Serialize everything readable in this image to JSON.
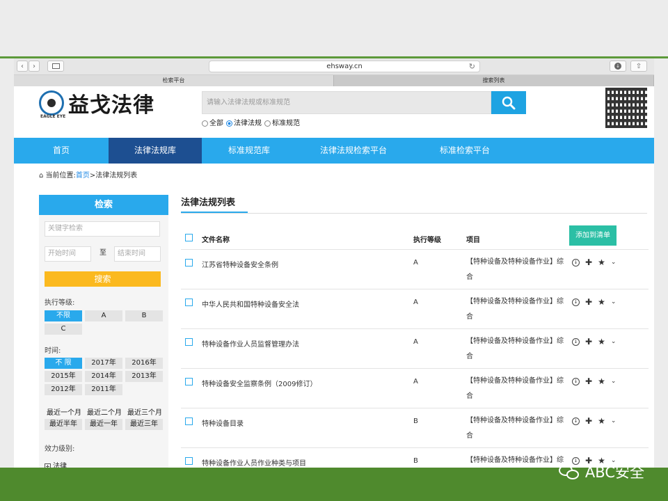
{
  "browser": {
    "url": "ehsway.cn",
    "tabs": [
      "检索平台",
      "搜索列表"
    ]
  },
  "header": {
    "logo_text": "益戈法律",
    "logo_sub": "EAGLE EYE",
    "search_placeholder": "请输入法律法规或标准规范",
    "radio_options": [
      "全部",
      "法律法规",
      "标准规范"
    ],
    "radio_selected": "法律法规"
  },
  "nav": {
    "items": [
      "首页",
      "法律法规库",
      "标准规范库",
      "法律法规检索平台",
      "标准检索平台"
    ],
    "active": "法律法规库"
  },
  "breadcrumb": {
    "prefix": "当前位置:",
    "home": "首页",
    "current": ">法律法规列表"
  },
  "sidebar": {
    "title": "检索",
    "keyword_placeholder": "关键字检索",
    "start_placeholder": "开始时间",
    "to_label": "至",
    "end_placeholder": "结束时间",
    "search_label": "搜索",
    "level_label": "执行等级:",
    "levels": [
      "不限",
      "A",
      "B",
      "C"
    ],
    "time_label": "时间:",
    "years": [
      "不 限",
      "2017年",
      "2016年",
      "2015年",
      "2014年",
      "2013年",
      "2012年",
      "2011年"
    ],
    "recent": [
      "最近一个月",
      "最近二个月",
      "最近三个月",
      "最近半年",
      "最近一年",
      "最近三年"
    ],
    "effect_label": "效力级别:",
    "effect_first": "法律"
  },
  "main": {
    "title": "法律法规列表",
    "add_button": "添加到清单",
    "columns": [
      "文件名称",
      "执行等级",
      "项目"
    ],
    "rows": [
      {
        "name": "江苏省特种设备安全条例",
        "level": "A",
        "project": "【特种设备及特种设备作业】综合"
      },
      {
        "name": "中华人民共和国特种设备安全法",
        "level": "A",
        "project": "【特种设备及特种设备作业】综合"
      },
      {
        "name": "特种设备作业人员监督管理办法",
        "level": "A",
        "project": "【特种设备及特种设备作业】综合"
      },
      {
        "name": "特种设备安全监察条例（2009修订）",
        "level": "A",
        "project": "【特种设备及特种设备作业】综合"
      },
      {
        "name": "特种设备目录",
        "level": "B",
        "project": "【特种设备及特种设备作业】综合"
      },
      {
        "name": "特种设备作业人员作业种类与项目",
        "level": "B",
        "project": "【特种设备及特种设备作业】综合"
      }
    ]
  },
  "watermark": "ABC安全",
  "colors": {
    "frame_green": "#4f8a2d",
    "nav_blue": "#29a9ec",
    "nav_active": "#1d4f91",
    "search_yellow": "#fbb91f",
    "add_teal": "#2bbfa5"
  }
}
